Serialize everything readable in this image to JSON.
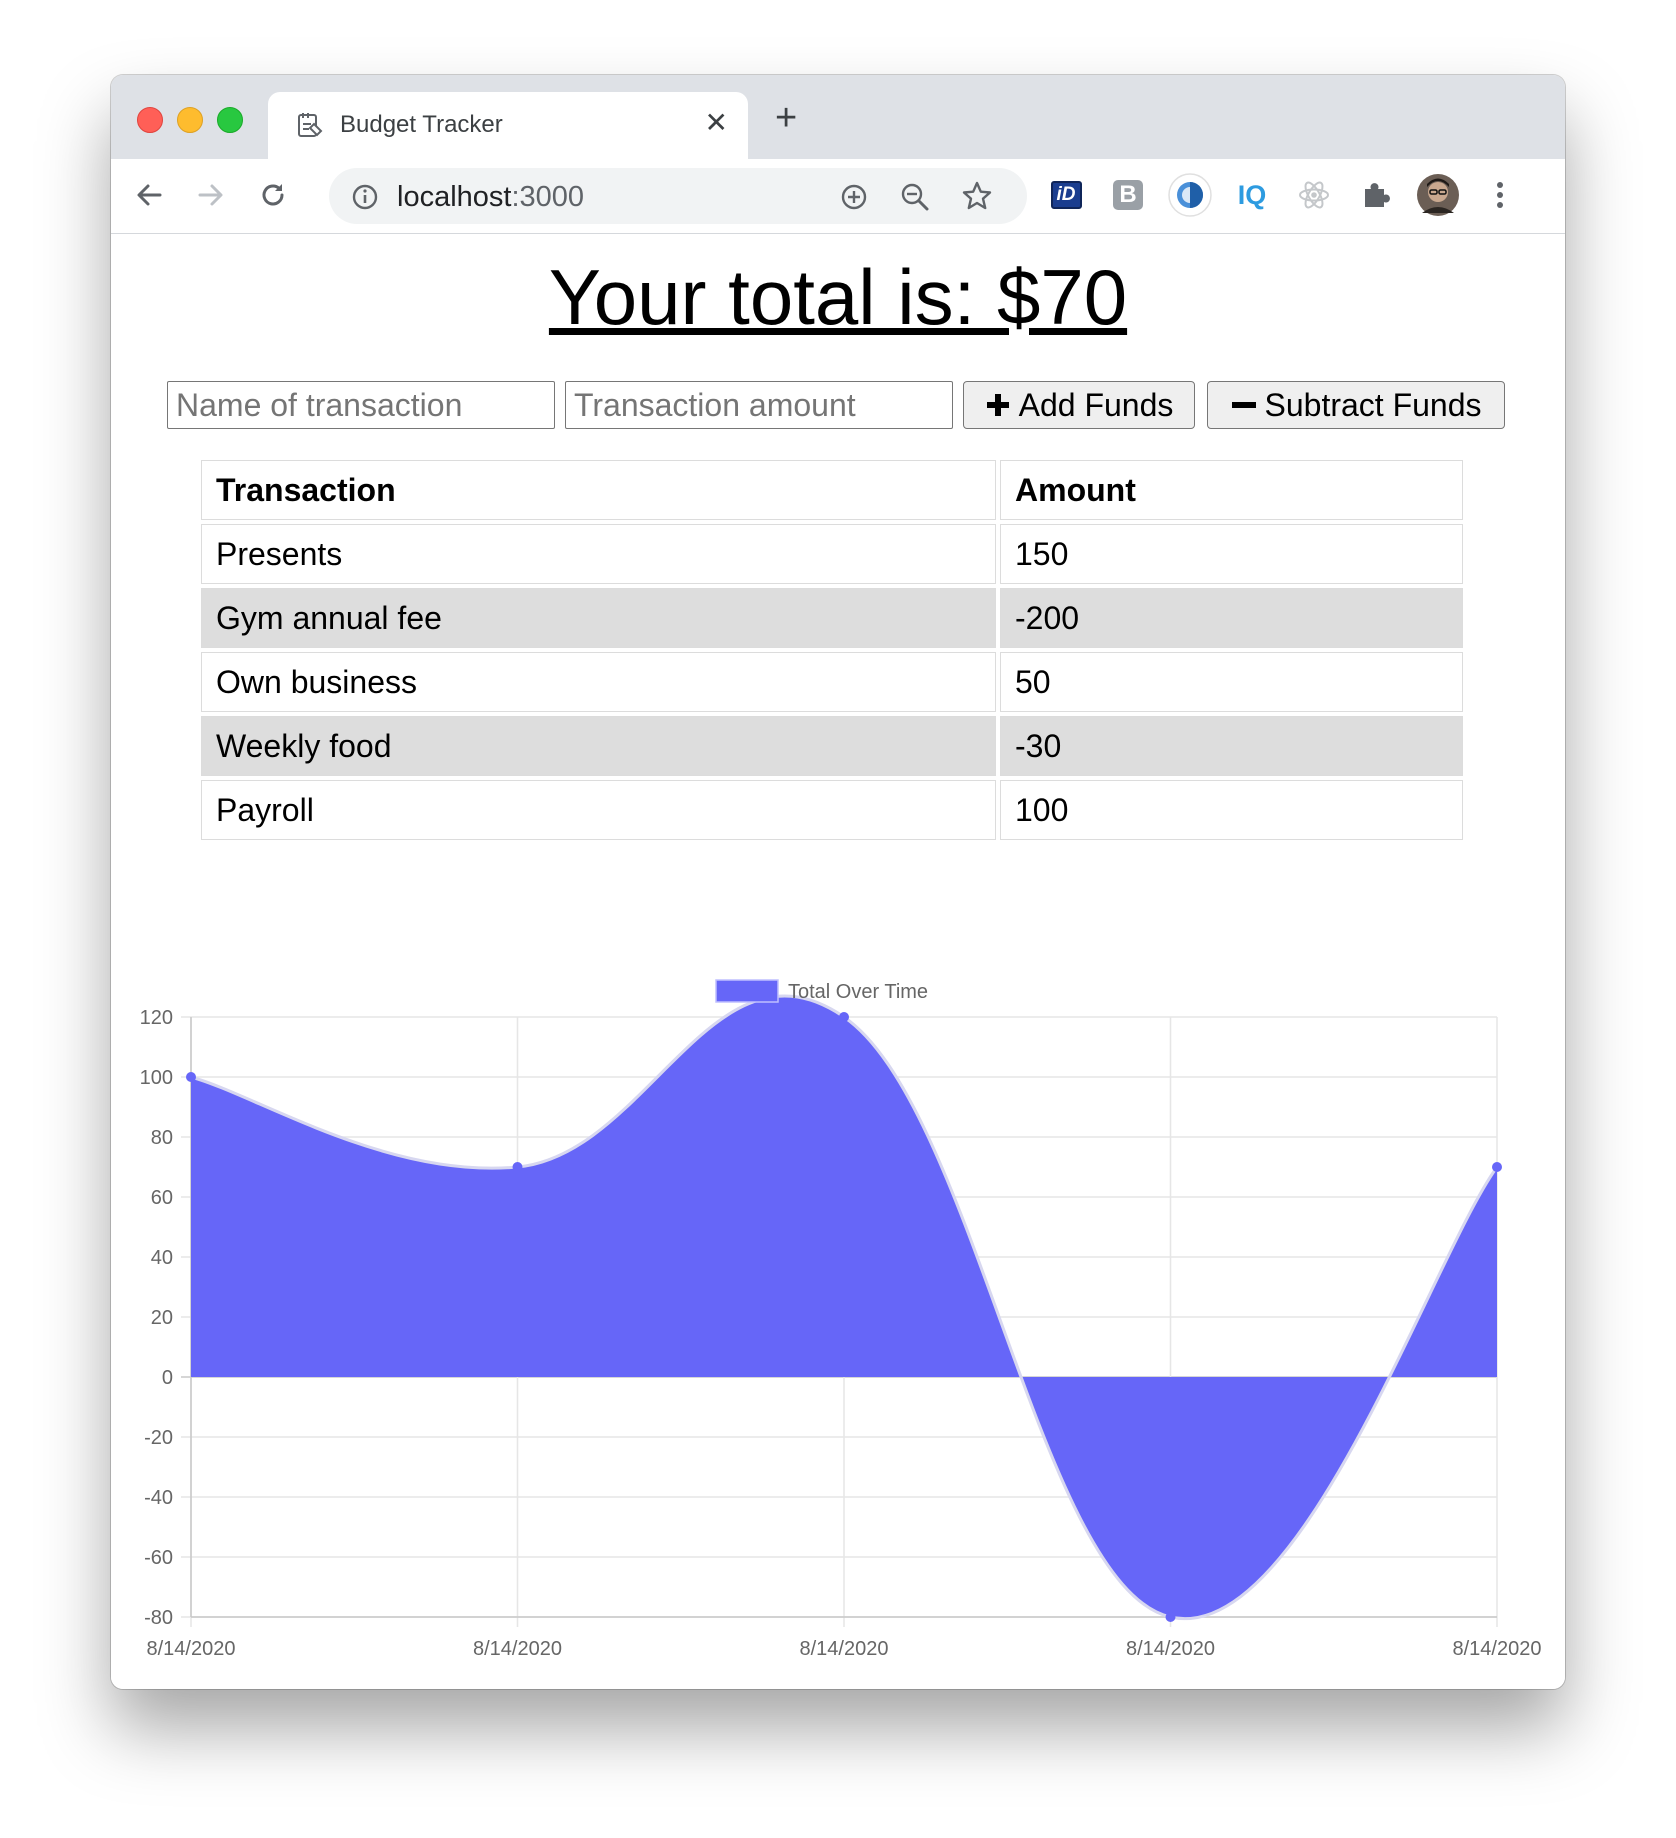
{
  "browser": {
    "tab_title": "Budget Tracker",
    "url_host": "localhost",
    "url_port": ":3000",
    "icons": [
      "back-icon",
      "forward-icon",
      "reload-icon",
      "info-icon",
      "add-icon",
      "zoom-out-icon",
      "star-icon",
      "id-extension-icon",
      "b-extension-icon",
      "circle-extension-icon",
      "iq-extension-icon",
      "react-extension-icon",
      "puzzle-icon",
      "avatar",
      "menu-icon"
    ],
    "ext_labels": {
      "id": "iD",
      "b": "B",
      "iq": "IQ"
    }
  },
  "page": {
    "total_text": "Your total is: $70",
    "name_placeholder": "Name of transaction",
    "amount_placeholder": "Transaction amount",
    "add_label": "Add Funds",
    "subtract_label": "Subtract Funds",
    "add_icon": "plus-icon",
    "subtract_icon": "minus-icon"
  },
  "table": {
    "headers": {
      "transaction": "Transaction",
      "amount": "Amount"
    },
    "rows": [
      {
        "name": "Presents",
        "amount": "150"
      },
      {
        "name": "Gym annual fee",
        "amount": "-200"
      },
      {
        "name": "Own business",
        "amount": "50"
      },
      {
        "name": "Weekly food",
        "amount": "-30"
      },
      {
        "name": "Payroll",
        "amount": "100"
      }
    ]
  },
  "chart_data": {
    "type": "area",
    "legend": [
      "Total Over Time"
    ],
    "legend_position": "top-center",
    "x": [
      "8/14/2020",
      "8/14/2020",
      "8/14/2020",
      "8/14/2020",
      "8/14/2020"
    ],
    "series": [
      {
        "name": "Total Over Time",
        "values": [
          100,
          70,
          120,
          -80,
          70
        ]
      }
    ],
    "ylim": [
      -80,
      120
    ],
    "yticks": [
      120,
      100,
      80,
      60,
      40,
      20,
      0,
      -20,
      -40,
      -60,
      -80
    ],
    "grid": true,
    "colors": {
      "fill": "#6666f8",
      "stroke": "#d7d7f0",
      "point": "#6666f8"
    }
  }
}
